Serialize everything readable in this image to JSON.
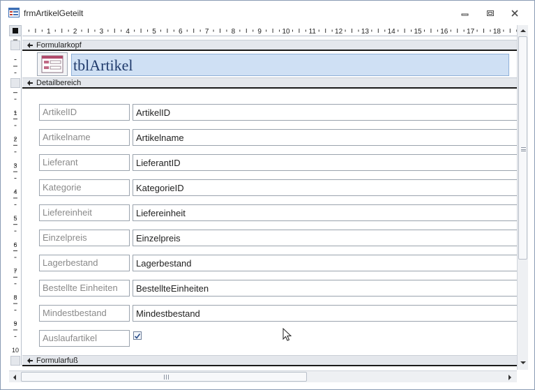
{
  "window": {
    "title": "frmArtikelGeteilt",
    "icons": {
      "app": "form-icon",
      "minimize": "minimize-icon",
      "maximize": "maximize-icon",
      "close": "close-icon"
    }
  },
  "ruler": {
    "horizontal_ticks": [
      "1",
      "2",
      "3",
      "4",
      "5",
      "6",
      "7",
      "8",
      "9",
      "10",
      "11",
      "12",
      "13",
      "14",
      "15",
      "16",
      "17",
      "18"
    ],
    "vertical_ticks": [
      "1",
      "2",
      "3",
      "4",
      "5",
      "6",
      "7",
      "8",
      "9",
      "10"
    ]
  },
  "sections": {
    "header": "Formularkopf",
    "detail": "Detailbereich",
    "footer": "Formularfuß"
  },
  "header": {
    "title": "tblArtikel",
    "title_bg": "#cfe0f4",
    "title_color": "#1f3a6b"
  },
  "fields": [
    {
      "label": "ArtikelID",
      "control": "ArtikelID"
    },
    {
      "label": "Artikelname",
      "control": "Artikelname"
    },
    {
      "label": "Lieferant",
      "control": "LieferantID"
    },
    {
      "label": "Kategorie",
      "control": "KategorieID"
    },
    {
      "label": "Liefereinheit",
      "control": "Liefereinheit"
    },
    {
      "label": "Einzelpreis",
      "control": "Einzelpreis"
    },
    {
      "label": "Lagerbestand",
      "control": "Lagerbestand"
    },
    {
      "label": "Bestellte Einheiten",
      "control": "BestellteEinheiten"
    },
    {
      "label": "Mindestbestand",
      "control": "Mindestbestand"
    },
    {
      "label": "Auslaufartikel",
      "control": ""
    }
  ],
  "checkbox": {
    "name": "Auslaufartikel",
    "checked": true
  }
}
